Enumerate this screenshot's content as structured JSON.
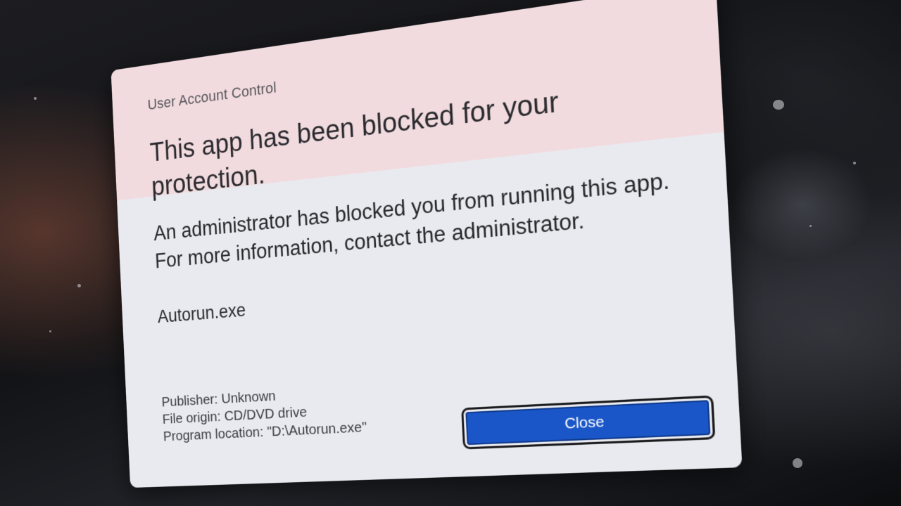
{
  "dialog": {
    "window_label": "User Account Control",
    "headline": "This app has been blocked for your protection.",
    "message": "An administrator has blocked you from running this app. For more information, contact the administrator.",
    "app_name": "Autorun.exe",
    "details": {
      "publisher": "Publisher: Unknown",
      "file_origin": "File origin: CD/DVD drive",
      "program_location": "Program location: \"D:\\Autorun.exe\""
    },
    "close_label": "Close"
  },
  "colors": {
    "header_background": "#f1dbdf",
    "body_background": "#e9eaef",
    "button_accent": "#1a56c8"
  }
}
